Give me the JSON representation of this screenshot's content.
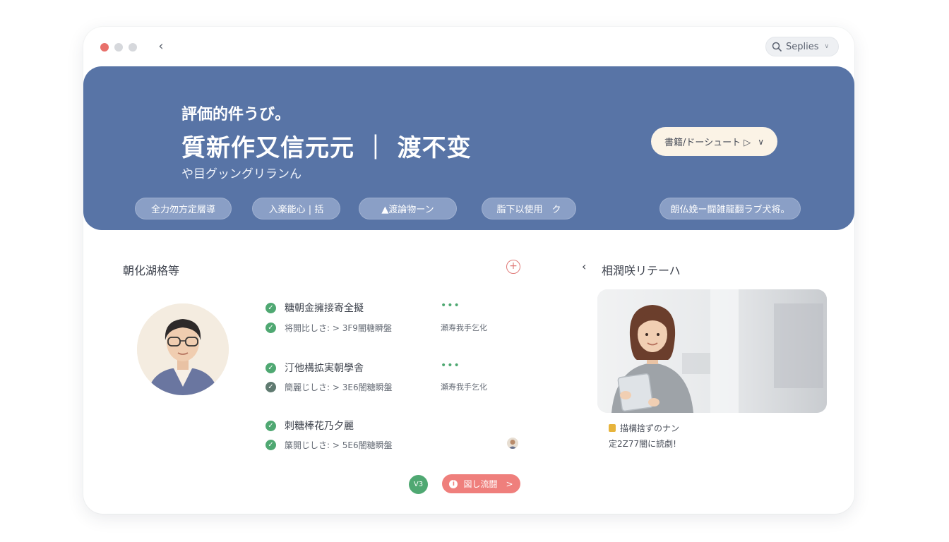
{
  "window": {
    "back_icon": "back-arrow-icon",
    "search": {
      "label": "Seplies"
    }
  },
  "hero": {
    "kicker": "評価的件うび。",
    "title": "質新作又信元元 ｜ 渡不变",
    "subtitle": "や目グッングリランん",
    "dropdown_label": "書籍/ドーシュート ▷",
    "chips": [
      {
        "label": "全力勿方定層導"
      },
      {
        "label": "入楽能心 | 括"
      },
      {
        "label": "▲渡論物ーン"
      },
      {
        "label": "脂下以使用　ク"
      },
      {
        "label": "朗仏娩ー闘雑龍翻ラブ犬将。"
      }
    ]
  },
  "tasks_section": {
    "title": "朝化湖格等",
    "add_icon": "plus-circle-icon",
    "tasks": [
      {
        "title": "糖朝金擁接寄全擬",
        "meta": "将開比しさ: > 3F9闇糖瞬盤",
        "side": "•••",
        "side_meta": "瀬寿我手乞化"
      },
      {
        "title": "汀他構拡実朝學舎",
        "meta": "簡麗じしさ: > 3E6闇糖瞬盤",
        "side": "•••",
        "side_meta": "瀬寿我手乞化"
      },
      {
        "title": "刺糖棒花乃夕麗",
        "meta": "簾開じしさ: > 5E6闇糖瞬盤",
        "side": "",
        "side_meta": ""
      }
    ],
    "badge": "V3",
    "action_label": "図し流闘　>"
  },
  "right_section": {
    "title": "相潤咲リテーハ",
    "caption_line1": "描構捨ずのナン",
    "caption_line2": "定2Z77闇に読劇!"
  },
  "colors": {
    "hero_bg": "#5874a6",
    "accent_green": "#4fa872",
    "accent_coral": "#ef7f7c",
    "dropdown_bg": "#fbf3e6"
  }
}
